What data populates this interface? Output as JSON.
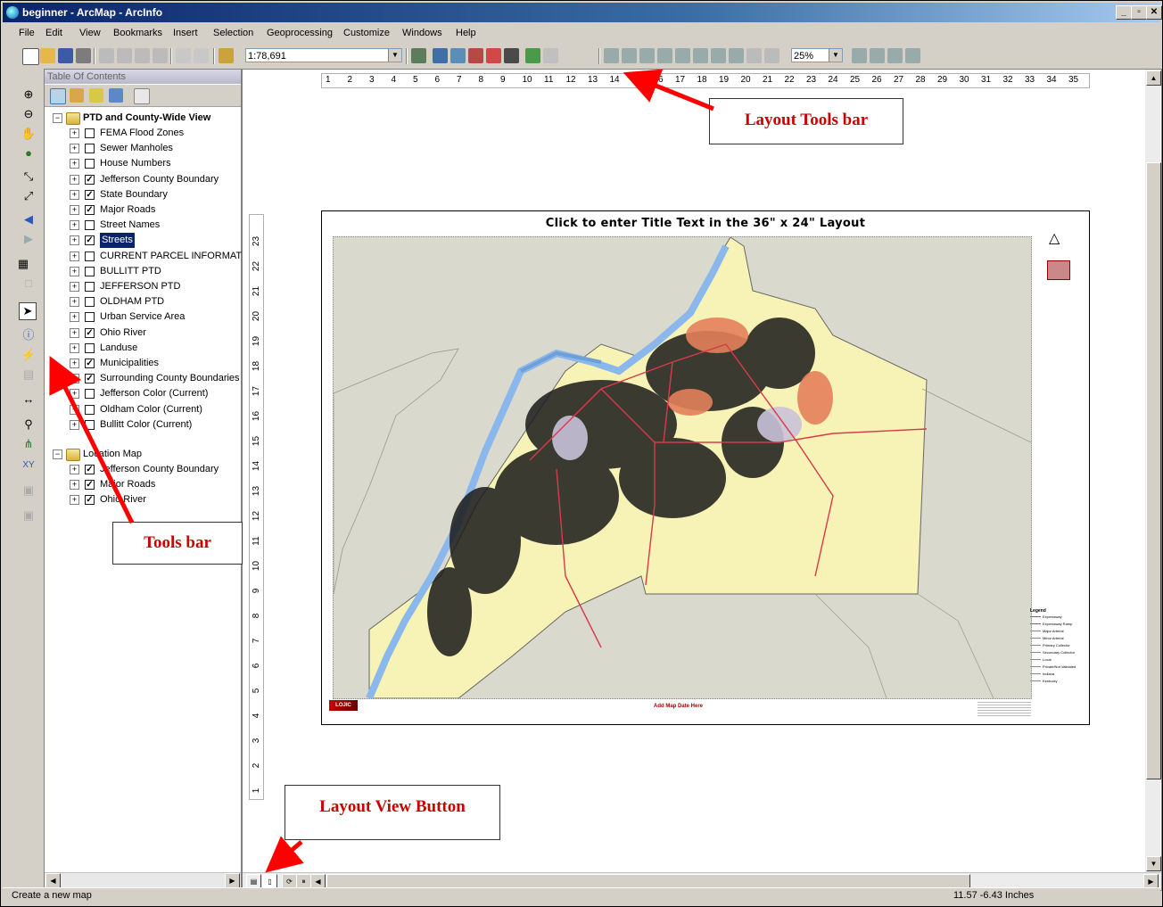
{
  "window": {
    "title": "beginner - ArcMap - ArcInfo",
    "controls": [
      "_",
      "▫",
      "✕"
    ]
  },
  "menu": [
    "File",
    "Edit",
    "View",
    "Bookmarks",
    "Insert",
    "Selection",
    "Geoprocessing",
    "Customize",
    "Windows",
    "Help"
  ],
  "toolbar": {
    "scale_value": "1:78,691",
    "zoom_percent": "25%"
  },
  "toc": {
    "title": "Table Of Contents",
    "groups": [
      {
        "name": "PTD and County-Wide View",
        "layers": [
          {
            "label": "FEMA Flood Zones",
            "checked": false
          },
          {
            "label": "Sewer Manholes",
            "checked": false
          },
          {
            "label": "House Numbers",
            "checked": false
          },
          {
            "label": "Jefferson County Boundary",
            "checked": true
          },
          {
            "label": "State Boundary",
            "checked": true
          },
          {
            "label": "Major Roads",
            "checked": true
          },
          {
            "label": "Street Names",
            "checked": false
          },
          {
            "label": "Streets",
            "checked": true
          },
          {
            "label": "CURRENT PARCEL INFORMATIC",
            "checked": false
          },
          {
            "label": "BULLITT PTD",
            "checked": false
          },
          {
            "label": "JEFFERSON PTD",
            "checked": false
          },
          {
            "label": "OLDHAM PTD",
            "checked": false
          },
          {
            "label": "Urban Service Area",
            "checked": false
          },
          {
            "label": "Ohio River",
            "checked": true
          },
          {
            "label": "Landuse",
            "checked": false
          },
          {
            "label": "Municipalities",
            "checked": true
          },
          {
            "label": "Surrounding County Boundaries",
            "checked": true
          },
          {
            "label": "Jefferson Color (Current)",
            "checked": false
          },
          {
            "label": "Oldham Color (Current)",
            "checked": false
          },
          {
            "label": "Bullitt  Color (Current)",
            "checked": false
          }
        ]
      },
      {
        "name": "Location Map",
        "layers": [
          {
            "label": "Jefferson County Boundary",
            "checked": true
          },
          {
            "label": "Major Roads",
            "checked": true
          },
          {
            "label": "Ohio River",
            "checked": true
          }
        ]
      }
    ]
  },
  "layout": {
    "page_title": "Click to enter Title Text in the 36\" x 24\" Layout",
    "footer_text": "Add Map Date Here",
    "legend_title": "Legend",
    "legend_items": [
      "Expressway",
      "Expressway Ramp",
      "Major Arterial",
      "Minor Arterial",
      "Primary Collector",
      "Secondary Collector",
      "Local",
      "Private/Not Validated",
      "Indiana",
      "Kentucky"
    ],
    "hruler": [
      "1",
      "2",
      "3",
      "4",
      "5",
      "6",
      "7",
      "8",
      "9",
      "10",
      "11",
      "12",
      "13",
      "14",
      "15",
      "16",
      "17",
      "18",
      "19",
      "20",
      "21",
      "22",
      "23",
      "24",
      "25",
      "26",
      "27",
      "28",
      "29",
      "30",
      "31",
      "32",
      "33",
      "34",
      "35"
    ],
    "vruler": [
      "1",
      "2",
      "3",
      "4",
      "5",
      "6",
      "7",
      "8",
      "9",
      "10",
      "11",
      "12",
      "13",
      "14",
      "15",
      "16",
      "17",
      "18",
      "19",
      "20",
      "21",
      "22",
      "23"
    ]
  },
  "callouts": {
    "layout_tools": "Layout Tools bar",
    "tools": "Tools bar",
    "layout_view": "Layout View Button"
  },
  "status": {
    "message": "Create a new map",
    "coords": "11.57  -6.43 Inches"
  },
  "colors": {
    "callout_text": "#cc0000",
    "arrow": "#ff0000",
    "map_fill": "#f7f2b6",
    "river": "#8ab8ec"
  }
}
